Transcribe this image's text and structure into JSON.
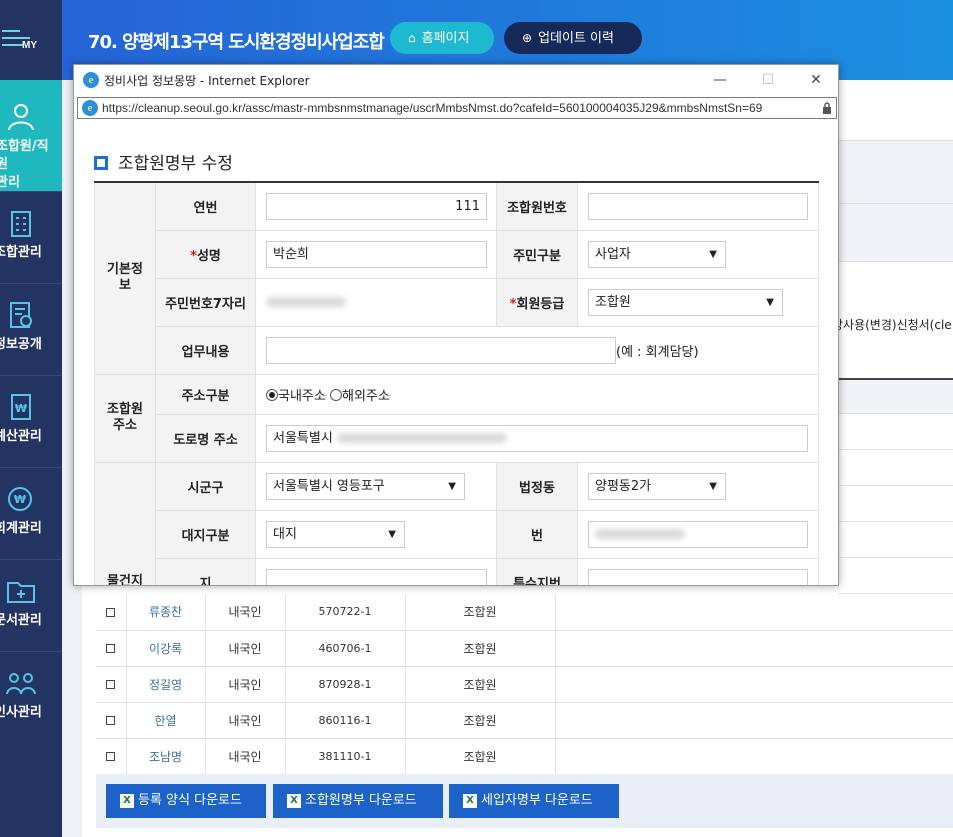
{
  "sidebar": {
    "logo_text": "MY",
    "items": [
      {
        "label": "조합원/직원\n관리",
        "icon": "person-icon"
      },
      {
        "label": "조합관리",
        "icon": "building-icon"
      },
      {
        "label": "정보공개",
        "icon": "document-search-icon"
      },
      {
        "label": "예산관리",
        "icon": "budget-icon"
      },
      {
        "label": "회계관리",
        "icon": "won-coin-icon"
      },
      {
        "label": "문서관리",
        "icon": "folder-plus-icon"
      },
      {
        "label": "인사관리",
        "icon": "people-group-icon"
      }
    ]
  },
  "header": {
    "title": "70. 양평제13구역 도시환경정비사업조합",
    "home_button": "홈페이지",
    "update_button": "업데이트 이력"
  },
  "background_page": {
    "partial_text": "장사용(변경)신청서(cle"
  },
  "members": {
    "rows": [
      {
        "name": "류종찬",
        "nationality": "내국인",
        "rrn": "570722-1",
        "grade": "조합원"
      },
      {
        "name": "이강록",
        "nationality": "내국인",
        "rrn": "460706-1",
        "grade": "조합원"
      },
      {
        "name": "정길영",
        "nationality": "내국인",
        "rrn": "870928-1",
        "grade": "조합원"
      },
      {
        "name": "한열",
        "nationality": "내국인",
        "rrn": "860116-1",
        "grade": "조합원"
      },
      {
        "name": "조남명",
        "nationality": "내국인",
        "rrn": "381110-1",
        "grade": "조합원"
      }
    ],
    "buttons": {
      "form_download": "등록 양식 다운로드",
      "member_download": "조합원명부 다운로드",
      "tenant_download": "세입자명부 다운로드"
    }
  },
  "popup": {
    "window_title": "정비사업 정보몽땅 - Internet Explorer",
    "url": "https://cleanup.seoul.go.kr/assc/mastr-mmbsnmstmanage/uscrMmbsNmst.do?cafeId=560100004035J29&mmbsNmstSn=69",
    "form_title": "조합원명부 수정",
    "groups": {
      "basic": "기본정\n보",
      "address": "조합원\n주소",
      "property": "물건지\n주소"
    },
    "labels": {
      "serial": "연번",
      "member_no": "조합원번호",
      "name": "성명",
      "resident_type": "주민구분",
      "rrn7": "주민번호7자리",
      "member_grade": "회원등급",
      "duty": "업무내용",
      "addr_type": "주소구분",
      "road_addr": "도로명 주소",
      "sigungu": "시군구",
      "legal_dong": "법정동",
      "land_type": "대지구분",
      "bun": "번",
      "ji": "지",
      "special_bun": "특수지번",
      "required_mark": "*"
    },
    "values": {
      "serial": "111",
      "member_no": "",
      "name": "박순희",
      "resident_type": "사업자",
      "member_grade": "조합원",
      "duty_hint": "(예 : 회계담당)",
      "addr_domestic": "국내주소",
      "addr_foreign": "해외주소",
      "road_addr": "서울특별시",
      "sigungu": "서울특별시 영등포구",
      "legal_dong": "양평동2가",
      "land_type": "대지"
    }
  }
}
